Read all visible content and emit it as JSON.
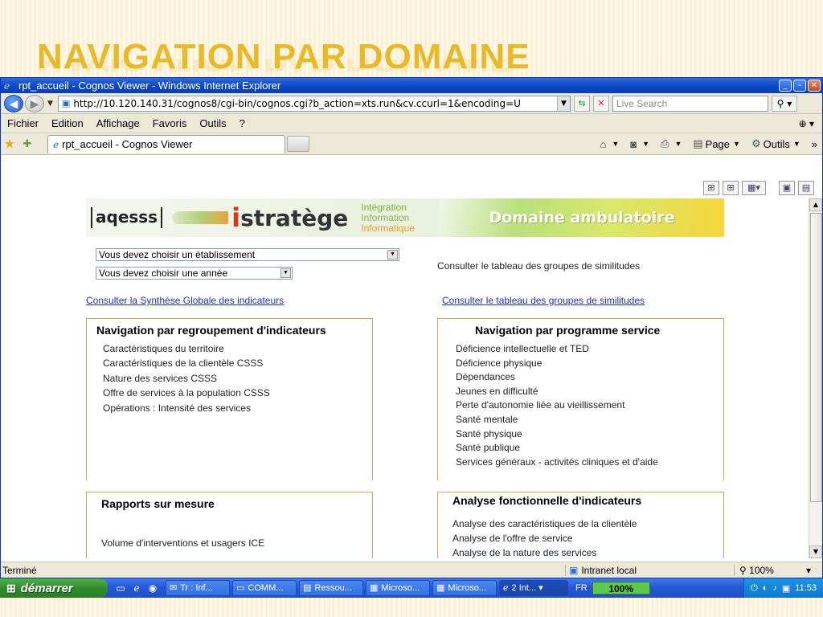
{
  "slide": {
    "title": "NAVIGATION PAR DOMAINE"
  },
  "window": {
    "title": "rpt_accueil - Cognos Viewer - Windows Internet Explorer",
    "controls": {
      "minimize": "_",
      "maximize": "▫",
      "close": "✕"
    }
  },
  "address": {
    "url": "http://10.120.140.31/cognos8/cgi-bin/cognos.cgi?b_action=xts.run&cv.ccurl=1&encoding=U",
    "search_placeholder": "Live Search"
  },
  "menu": {
    "items": [
      "Fichier",
      "Edition",
      "Affichage",
      "Favoris",
      "Outils",
      "?"
    ]
  },
  "tabs": {
    "active_tab": "rpt_accueil - Cognos Viewer",
    "commands": {
      "page": "Page",
      "tools": "Outils"
    }
  },
  "banner": {
    "logo_aqesss": "aqesss",
    "logo_i": "i",
    "logo_stratege": "stratège",
    "tag_1": "Intégration",
    "tag_2": "Information",
    "tag_3": "Informatique",
    "domain": "Domaine ambulatoire"
  },
  "filters": {
    "establishment_select": "Vous devez choisir un établissement",
    "year_select": "Vous devez choisir une année",
    "similarity_text": "Consulter le tableau des groupes de similitudes"
  },
  "links": {
    "global_synthesis": "Consulter la Synthèse Globale des indicateurs",
    "similarity_groups": "Consulter le tableau des groupes de similitudes"
  },
  "panels": {
    "grouping": {
      "title": "Navigation par regroupement d'indicateurs",
      "items": [
        "Caractéristiques du territoire",
        "Caractéristiques de la clientèle CSSS",
        "Nature des services CSSS",
        "Offre de services à la population CSSS",
        "Opérations : Intensité des services"
      ]
    },
    "program": {
      "title": "Navigation par programme service",
      "items": [
        "Déficience intellectuelle et TED",
        "Déficience physique",
        "Dépendances",
        "Jeunes en difficulté",
        "Perte d'autonomie liée au vieillissement",
        "Santé mentale",
        "Santé physique",
        "Santé publique",
        "Services généraux - activités cliniques et d'aide"
      ]
    },
    "custom_reports": {
      "title": "Rapports sur mesure",
      "items": [
        "Volume d'interventions et usagers ICE"
      ]
    },
    "functional": {
      "title": "Analyse fonctionnelle d'indicateurs",
      "items": [
        "Analyse des caractéristiques de la clientèle",
        "Analyse de l'offre de service",
        "Analyse de la nature des services"
      ]
    }
  },
  "status": {
    "text": "Terminé",
    "zone": "Intranet local",
    "zoom": "100%"
  },
  "taskbar": {
    "start": "démarrer",
    "buttons": [
      "Tr : Inf...",
      "COMM...",
      "Ressou...",
      "Microso...",
      "Microso...",
      "2 Int..."
    ],
    "lang": "FR",
    "battery": "100%",
    "clock": "11:53"
  },
  "colors": {
    "slide_title": "#e8b92a",
    "panel_border": "#c9a75a",
    "link": "#1a2fbd",
    "xp_blue": "#2458d6",
    "start_green": "#2f8b2c"
  }
}
